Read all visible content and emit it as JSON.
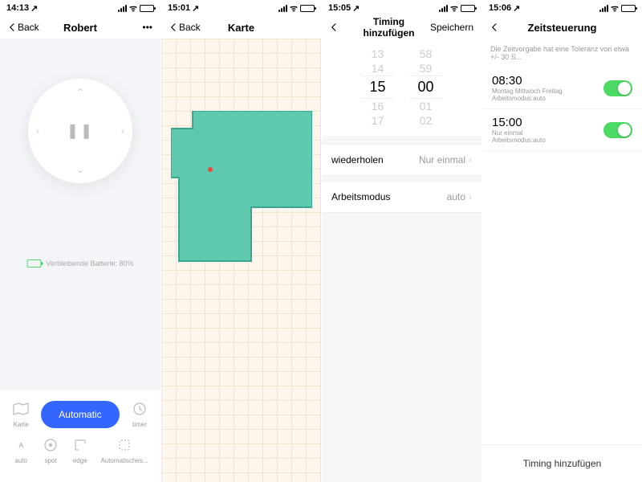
{
  "phone1": {
    "time": "14:13",
    "back": "Back",
    "title": "Robert",
    "battery_label": "Verbleibende Batterie: 80%",
    "bottom": {
      "karte": "Karte",
      "automatic": "Automatic",
      "timer": "timer",
      "auto": "auto",
      "spot": "spot",
      "edge": "edge",
      "last": "Automatisches..."
    }
  },
  "phone2": {
    "time": "15:01",
    "back": "Back",
    "title": "Karte"
  },
  "phone3": {
    "time": "15:05",
    "title": "Timing hinzufügen",
    "save": "Speichern",
    "picker": {
      "h_m2": "13",
      "h_m1": "14",
      "h_sel": "15",
      "h_p1": "16",
      "h_p2": "17",
      "m_m2": "58",
      "m_m1": "59",
      "m_sel": "00",
      "m_p1": "01",
      "m_p2": "02"
    },
    "row1_label": "wiederholen",
    "row1_value": "Nur einmal",
    "row2_label": "Arbeitsmodus",
    "row2_value": "auto"
  },
  "phone4": {
    "time": "15:06",
    "title": "Zeitsteuerung",
    "notice": "Die Zeitvorgabe hat eine Toleranz von etwa +/- 30 S...",
    "s1_time": "08:30",
    "s1_days": "Montag Mittwoch Freitag",
    "s1_mode": "Arbeitsmodus:auto",
    "s2_time": "15:00",
    "s2_days": "Nur einmal",
    "s2_mode": "Arbeitsmodus:auto",
    "footer": "Timing hinzufügen"
  }
}
